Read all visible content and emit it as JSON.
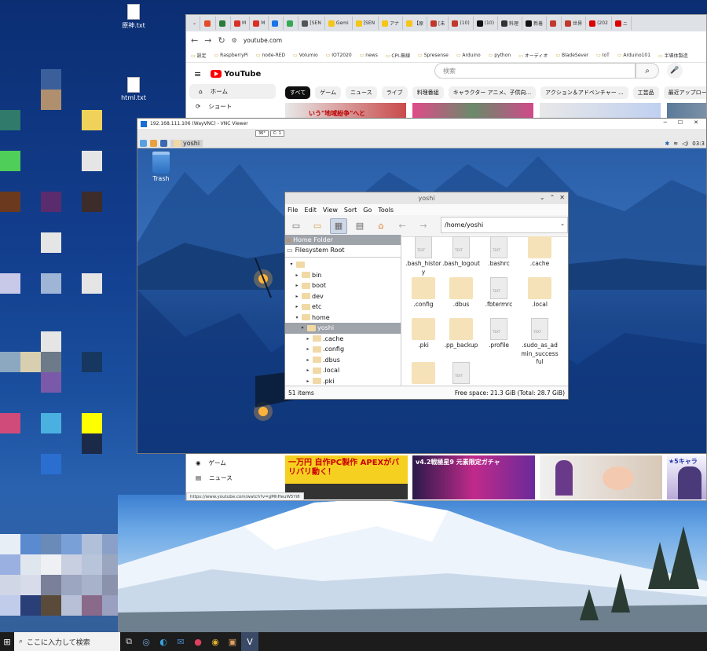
{
  "desktop": {
    "icons": [
      {
        "label": "原神.txt"
      },
      {
        "label": "html.txt"
      }
    ],
    "tile_colors": [
      "#3a5f9a",
      "#b08f6e",
      "#2f7a6a",
      "#f0d25a",
      "#4fce5a",
      "#e5e5e5",
      "#6b3a1e",
      "#5a2c6e",
      "#3c2c2a",
      "#e5e5e5",
      "#c8c8e8",
      "#e5e5e5",
      "#9fb5d5",
      "#e5e5e5",
      "#8ba8c0",
      "#d8cfb0",
      "#6c7a8a",
      "#16375f",
      "#7a5aa8",
      "#d04a7a",
      "#4ab0e0",
      "#ffff00",
      "#1c2a4a",
      "#2a6fd0"
    ]
  },
  "taskbar": {
    "search_placeholder": "ここに入力して検索",
    "apps": [
      "task-view",
      "steam",
      "edge",
      "mail",
      "app-red",
      "chrome",
      "app-image",
      "vnc"
    ]
  },
  "chrome": {
    "tabs": [
      {
        "label": "",
        "color": "#e34c26"
      },
      {
        "label": "",
        "color": "#2a7a3a"
      },
      {
        "label": "M",
        "color": "#d93025"
      },
      {
        "label": "M",
        "color": "#d93025"
      },
      {
        "label": "",
        "color": "#1a73e8"
      },
      {
        "label": "",
        "color": "#34a853"
      },
      {
        "label": "[SEN",
        "color": "#555"
      },
      {
        "label": "Gemi",
        "color": "#f5c518"
      },
      {
        "label": "[SEN",
        "color": "#f5c518"
      },
      {
        "label": "アナ",
        "color": "#f5c518"
      },
      {
        "label": "【原",
        "color": "#f5c518"
      },
      {
        "label": "[未",
        "color": "#c0392b"
      },
      {
        "label": "(10)",
        "color": "#c0392b"
      },
      {
        "label": "(10)",
        "color": "#111"
      },
      {
        "label": "料理",
        "color": "#333"
      },
      {
        "label": "新着",
        "color": "#111"
      },
      {
        "label": "",
        "color": "#c0392b"
      },
      {
        "label": "世界",
        "color": "#c0392b"
      },
      {
        "label": "(202",
        "color": "#d00"
      },
      {
        "label": "ニ",
        "color": "#d00"
      }
    ],
    "url": "youtube.com",
    "bookmarks": [
      "設定",
      "RaspberryPi",
      "node-RED",
      "Volumio",
      "IOT2020",
      "news",
      "CPI-無線",
      "Spresense",
      "Arduino",
      "python",
      "オーディオ",
      "BladeSever",
      "IoT",
      "Arduino101",
      "半導体製造"
    ],
    "status_url": "https://www.youtube.com/watch?v=gMhHeuW5Yi8"
  },
  "youtube": {
    "logo": "YouTube",
    "search_placeholder": "検索",
    "sidebar": [
      {
        "label": "ホーム",
        "icon": "home-icon"
      },
      {
        "label": "ショート",
        "icon": "shorts-icon"
      },
      {
        "label": "ゲーム",
        "icon": "game-icon"
      },
      {
        "label": "ニュース",
        "icon": "news-icon"
      }
    ],
    "chips": [
      "すべて",
      "ゲーム",
      "ニュース",
      "ライブ",
      "料理番組",
      "キャラクター アニメ、子供向...",
      "アクション＆アドベンチャー ...",
      "工芸品",
      "最近アップロードされ"
    ],
    "thumb_top_texts": [
      "いう\"地域紛争\"へと",
      "",
      "",
      ""
    ],
    "thumb_bottom_texts": [
      "一万円 自作PC製作 APEXがバリバリ動く！",
      "v4.2戦極星9 元素限定ガチャ",
      "",
      "★5キャラ"
    ]
  },
  "vnc": {
    "title": "192.168.111.106 (WayVNC) - VNC Viewer",
    "toolbar_boxes": [
      "36°",
      "C: 1"
    ],
    "panel_folder": "yoshi",
    "clock": "03:3",
    "desktop_icon": "Trash"
  },
  "filemanager": {
    "title": "yoshi",
    "menu": [
      "File",
      "Edit",
      "View",
      "Sort",
      "Go",
      "Tools"
    ],
    "path": "/home/yoshi",
    "places": [
      {
        "label": "Home Folder",
        "selected": true
      },
      {
        "label": "Filesystem Root",
        "selected": false
      }
    ],
    "tree": [
      {
        "label": "",
        "depth": 0,
        "arrow": "▾"
      },
      {
        "label": "bin",
        "depth": 1,
        "arrow": "▸"
      },
      {
        "label": "boot",
        "depth": 1,
        "arrow": "▸"
      },
      {
        "label": "dev",
        "depth": 1,
        "arrow": "▸"
      },
      {
        "label": "etc",
        "depth": 1,
        "arrow": "▸"
      },
      {
        "label": "home",
        "depth": 1,
        "arrow": "▾"
      },
      {
        "label": "yoshi",
        "depth": 2,
        "arrow": "▾",
        "selected": true
      },
      {
        "label": ".cache",
        "depth": 3,
        "arrow": "▸"
      },
      {
        "label": ".config",
        "depth": 3,
        "arrow": "▸"
      },
      {
        "label": ".dbus",
        "depth": 3,
        "arrow": "▸"
      },
      {
        "label": ".local",
        "depth": 3,
        "arrow": "▸"
      },
      {
        "label": ".pki",
        "depth": 3,
        "arrow": "▸"
      },
      {
        "label": ".pp_backup",
        "depth": 3,
        "arrow": "▸"
      }
    ],
    "files": [
      {
        "name": ".bash_history",
        "type": "file"
      },
      {
        "name": ".bash_logout",
        "type": "file"
      },
      {
        "name": ".bashrc",
        "type": "file"
      },
      {
        "name": ".cache",
        "type": "folder"
      },
      {
        "name": ".config",
        "type": "folder"
      },
      {
        "name": ".dbus",
        "type": "folder"
      },
      {
        "name": ".fbtermrc",
        "type": "file"
      },
      {
        "name": ".local",
        "type": "folder"
      },
      {
        "name": ".pki",
        "type": "folder"
      },
      {
        "name": ".pp_backup",
        "type": "folder"
      },
      {
        "name": ".profile",
        "type": "file"
      },
      {
        "name": ".sudo_as_admin_successful",
        "type": "file"
      },
      {
        "name": "",
        "type": "folder"
      },
      {
        "name": "",
        "type": "file"
      }
    ],
    "status_count": "51 items",
    "status_free": "Free space: 21.3 GiB (Total: 28.7 GiB)"
  }
}
